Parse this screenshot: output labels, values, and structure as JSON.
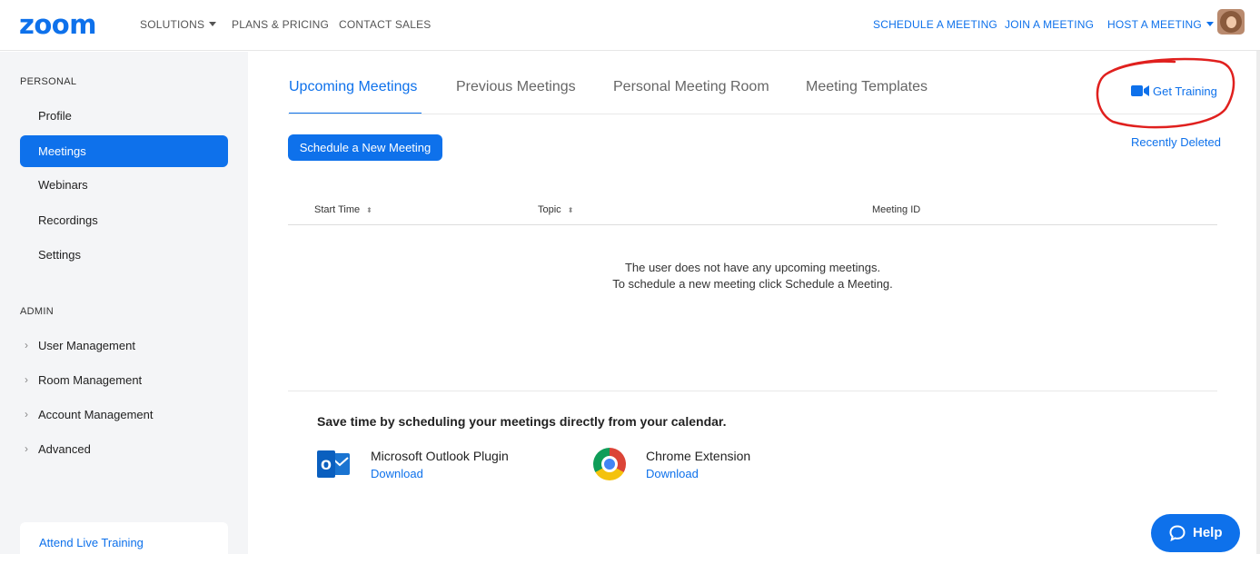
{
  "header": {
    "logo": "zoom",
    "nav_left": [
      "SOLUTIONS",
      "PLANS & PRICING",
      "CONTACT SALES"
    ],
    "nav_right": [
      "SCHEDULE A MEETING",
      "JOIN A MEETING",
      "HOST A MEETING"
    ]
  },
  "sidebar": {
    "personal_heading": "PERSONAL",
    "personal_items": [
      "Profile",
      "Meetings",
      "Webinars",
      "Recordings",
      "Settings"
    ],
    "active_item": "Meetings",
    "admin_heading": "ADMIN",
    "admin_items": [
      "User Management",
      "Room Management",
      "Account Management",
      "Advanced"
    ],
    "training_link": "Attend Live Training"
  },
  "main": {
    "tabs": [
      "Upcoming Meetings",
      "Previous Meetings",
      "Personal Meeting Room",
      "Meeting Templates"
    ],
    "active_tab": "Upcoming Meetings",
    "get_training": "Get Training",
    "recently_deleted": "Recently Deleted",
    "schedule_button": "Schedule a New Meeting",
    "table": {
      "headers": [
        "Start Time",
        "Topic",
        "Meeting ID"
      ]
    },
    "empty_message": [
      "The user does not have any upcoming meetings.",
      "To schedule a new meeting click Schedule a Meeting."
    ],
    "calendar": {
      "title": "Save time by scheduling your meetings directly from your calendar.",
      "plugins": [
        {
          "name": "Microsoft Outlook Plugin",
          "action": "Download",
          "icon": "outlook-icon"
        },
        {
          "name": "Chrome Extension",
          "action": "Download",
          "icon": "chrome-icon"
        }
      ]
    }
  },
  "help_button": "Help",
  "colors": {
    "brand": "#0e71eb",
    "annotation": "#e0201e",
    "sidebar_bg": "#f4f5f7"
  }
}
